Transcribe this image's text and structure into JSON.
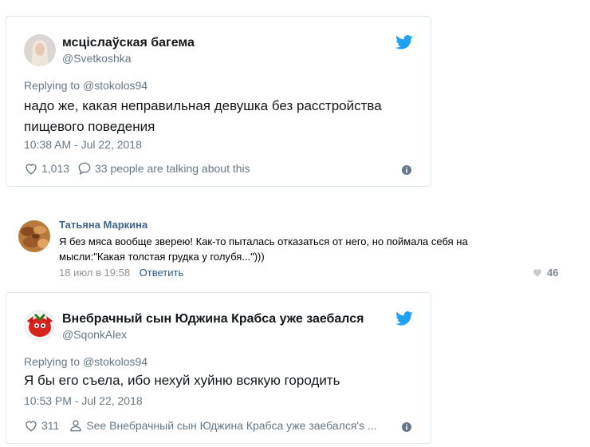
{
  "tweet1": {
    "name": "мсціслаўская багема",
    "handle": "@Svetkoshka",
    "replying_prefix": "Replying to",
    "replying_to": "@stokolos94",
    "text": "надо же, какая неправильная девушка без расстройства пищевого поведения",
    "timestamp": "10:38 AM - Jul 22, 2018",
    "likes": "1,013",
    "talking": "33 people are talking about this",
    "icons": {
      "like": "heart-icon",
      "comment": "speech-bubble-icon",
      "info": "info-icon",
      "logo": "twitter-bird-icon"
    }
  },
  "vk_comment": {
    "name": "Татьяна Маркина",
    "text": "Я без мяса вообще зверею! Как-то пыталась отказаться от него, но поймала себя на мысли:\"Какая толстая грудка у голубя...\")))",
    "date": "18 июл в 19:58",
    "reply_label": "Ответить",
    "likes": "46"
  },
  "tweet2": {
    "name": "Внебрачный сын Юджина Крабса уже заебался",
    "handle": "@SqonkAlex",
    "replying_prefix": "Replying to",
    "replying_to": "@stokolos94",
    "text": "Я бы его съела, ибо нехуй хуйню всякую городить",
    "timestamp": "10:53 PM - Jul 22, 2018",
    "likes": "311",
    "see_profile": "See Внебрачный сын Юджина Крабса уже заебался's ...",
    "icons": {
      "like": "heart-icon",
      "profile": "person-icon",
      "info": "info-icon",
      "logo": "twitter-bird-icon"
    }
  },
  "colors": {
    "twitter_blue": "#1da1f2",
    "vk_link": "#2a5885",
    "vk_name": "#42648b",
    "muted": "#657786"
  }
}
